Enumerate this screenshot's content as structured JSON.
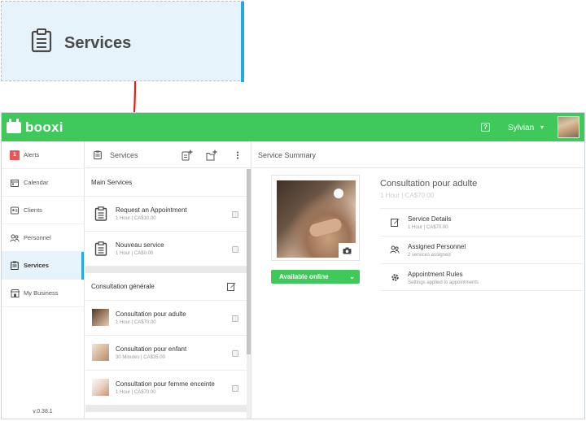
{
  "callout": {
    "icon": "clipboard-icon",
    "label": "Services",
    "accent": "#29a8e0"
  },
  "app": {
    "brand": "booxi",
    "brand_color": "#3ec95a",
    "user": "Sylvian",
    "version": "v.0.38.1"
  },
  "sidebar": {
    "items": [
      {
        "label": "Alerts",
        "badge": "1",
        "icon": "alerts-badge"
      },
      {
        "label": "Calendar",
        "icon": "calendar-icon"
      },
      {
        "label": "Clients",
        "icon": "clients-icon"
      },
      {
        "label": "Personnel",
        "icon": "personnel-icon"
      },
      {
        "label": "Services",
        "icon": "clipboard-icon",
        "active": true
      },
      {
        "label": "My Business",
        "icon": "store-icon"
      }
    ]
  },
  "services": {
    "title": "Services",
    "groups": [
      {
        "name": "Main Services",
        "items": [
          {
            "name": "Request an Appointment",
            "detail": "1 Hour | CA$10.00",
            "thumb": "clipboard-icon"
          },
          {
            "name": "Nouveau service",
            "detail": "1 Hour | CA$0.00",
            "thumb": "clipboard-icon"
          }
        ]
      },
      {
        "name": "Consultation générale",
        "items": [
          {
            "name": "Consultation pour adulte",
            "detail": "1 Hour | CA$70.00",
            "thumb": "photo"
          },
          {
            "name": "Consultation pour enfant",
            "detail": "30 Minutes | CA$35.00",
            "thumb": "photo"
          },
          {
            "name": "Consultation pour femme enceinte",
            "detail": "1 Hour | CA$70.00",
            "thumb": "photo"
          }
        ]
      }
    ]
  },
  "summary": {
    "header": "Service Summary",
    "title": "Consultation pour adulte",
    "subtitle": "1 Hour | CA$70.00",
    "availability": "Available online",
    "details": [
      {
        "name": "Service Details",
        "detail": "1 Hour | CA$70.00",
        "icon": "edit-icon"
      },
      {
        "name": "Assigned Personnel",
        "detail": "2 services assigned",
        "icon": "personnel-icon"
      },
      {
        "name": "Appointment Rules",
        "detail": "Settings applied to appointments",
        "icon": "gear-icon"
      }
    ]
  }
}
